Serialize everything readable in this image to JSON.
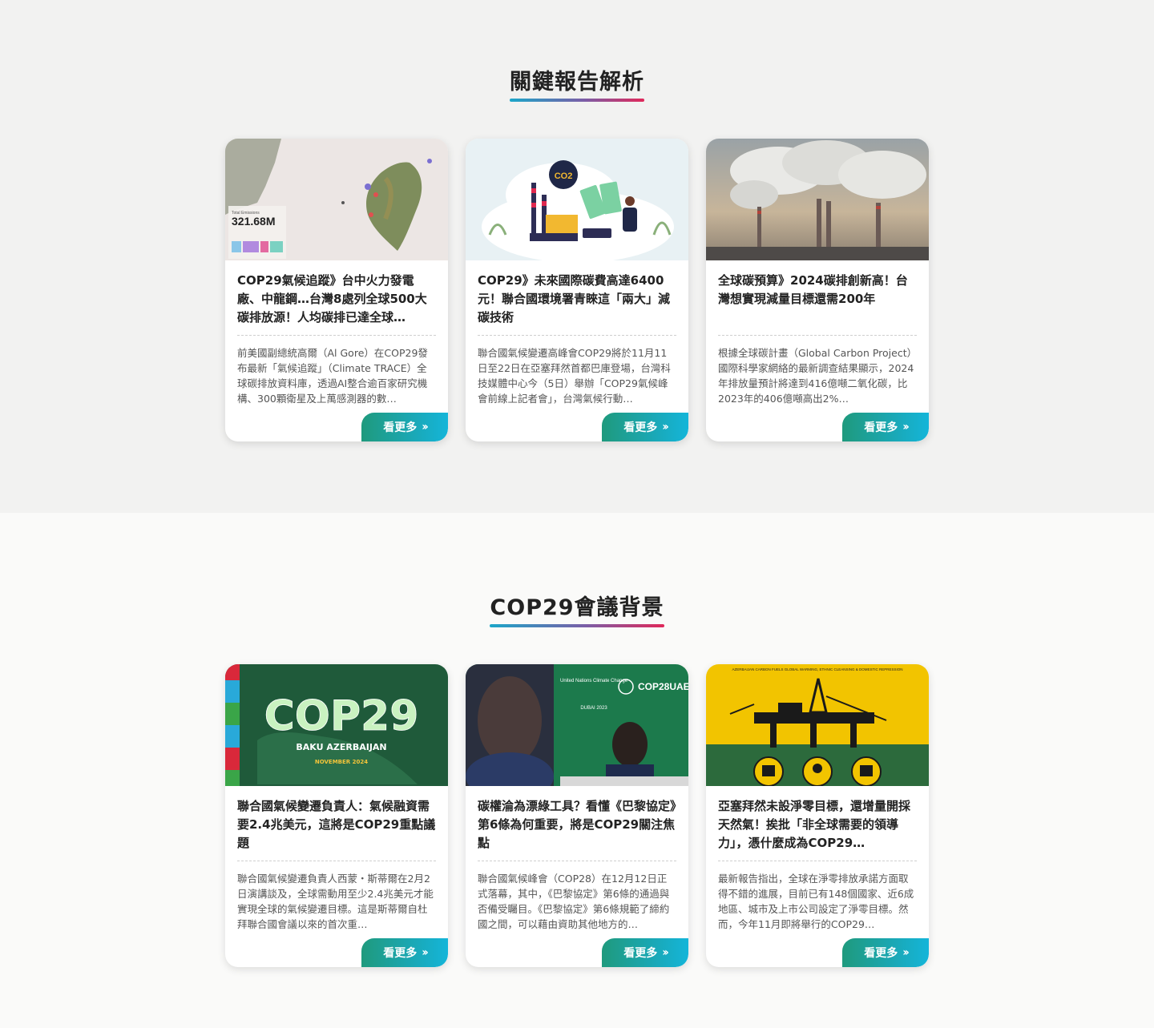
{
  "sections": [
    {
      "title": "關鍵報告解析",
      "cards": [
        {
          "title": "COP29氣候追蹤》台中火力發電廠、中龍鋼…台灣8處列全球500大碳排放源！人均碳排已達全球…",
          "excerpt": "前美國副總統高爾（Al Gore）在COP29發布最新「氣候追蹤」（Climate TRACE）全球碳排放資料庫，透過AI整合逾百家研究機構、300顆衛星及上萬感測器的數…",
          "more": "看更多",
          "thumb_overlay": "321.68M"
        },
        {
          "title": "COP29》未來國際碳費高達6400元！聯合國環境署青睞這「兩大」減碳技術",
          "excerpt": "聯合國氣候變遷高峰會COP29將於11月11日至22日在亞塞拜然首都巴庫登場，台灣科技媒體中心今（5日）舉辦「COP29氣候峰會前線上記者會」，台灣氣候行動…",
          "more": "看更多",
          "thumb_overlay": "CO2"
        },
        {
          "title": "全球碳預算》2024碳排創新高！台灣想實現減量目標還需200年",
          "excerpt": "根據全球碳計畫（Global Carbon Project）國際科學家網絡的最新調查結果顯示，2024年排放量預計將達到416億噸二氧化碳，比2023年的406億噸高出2%…",
          "more": "看更多",
          "thumb_overlay": ""
        }
      ]
    },
    {
      "title": "COP29會議背景",
      "cards": [
        {
          "title": "聯合國氣候變遷負責人：氣候融資需要2.4兆美元，這將是COP29重點議題",
          "excerpt": "聯合國氣候變遷負責人西蒙・斯蒂爾在2月2日演講談及，全球需動用至少2.4兆美元才能實現全球的氣候變遷目標。這是斯蒂爾自杜拜聯合國會議以來的首次重…",
          "more": "看更多",
          "thumb_overlay": "COP29",
          "thumb_sub": "BAKU AZERBAIJAN",
          "thumb_date": "NOVEMBER 2024"
        },
        {
          "title": "碳權淪為漂綠工具？看懂《巴黎協定》第6條為何重要，將是COP29關注焦點",
          "excerpt": "聯合國氣候峰會（COP28）在12月12日正式落幕，其中，《巴黎協定》第6條的通過與否備受矚目。《巴黎協定》第6條規範了締約國之間，可以藉由資助其他地方的…",
          "more": "看更多",
          "thumb_overlay": "COP28UAE",
          "thumb_sub": "United Nations Climate Change",
          "thumb_date": "DUBAI 2023"
        },
        {
          "title": "亞塞拜然未設淨零目標，還增量開採天然氣！挨批「非全球需要的領導力」，憑什麼成為COP29…",
          "excerpt": "最新報告指出，全球在淨零排放承諾方面取得不錯的進展，目前已有148個國家、近6成地區、城市及上市公司設定了淨零目標。然而，今年11月即將舉行的COP29…",
          "more": "看更多",
          "thumb_overlay": "AZERBAIJAN CARBON FUELS GLOBAL WARMING, ETHNIC CLEANSING & DOMESTIC REPRESSION"
        }
      ]
    }
  ]
}
